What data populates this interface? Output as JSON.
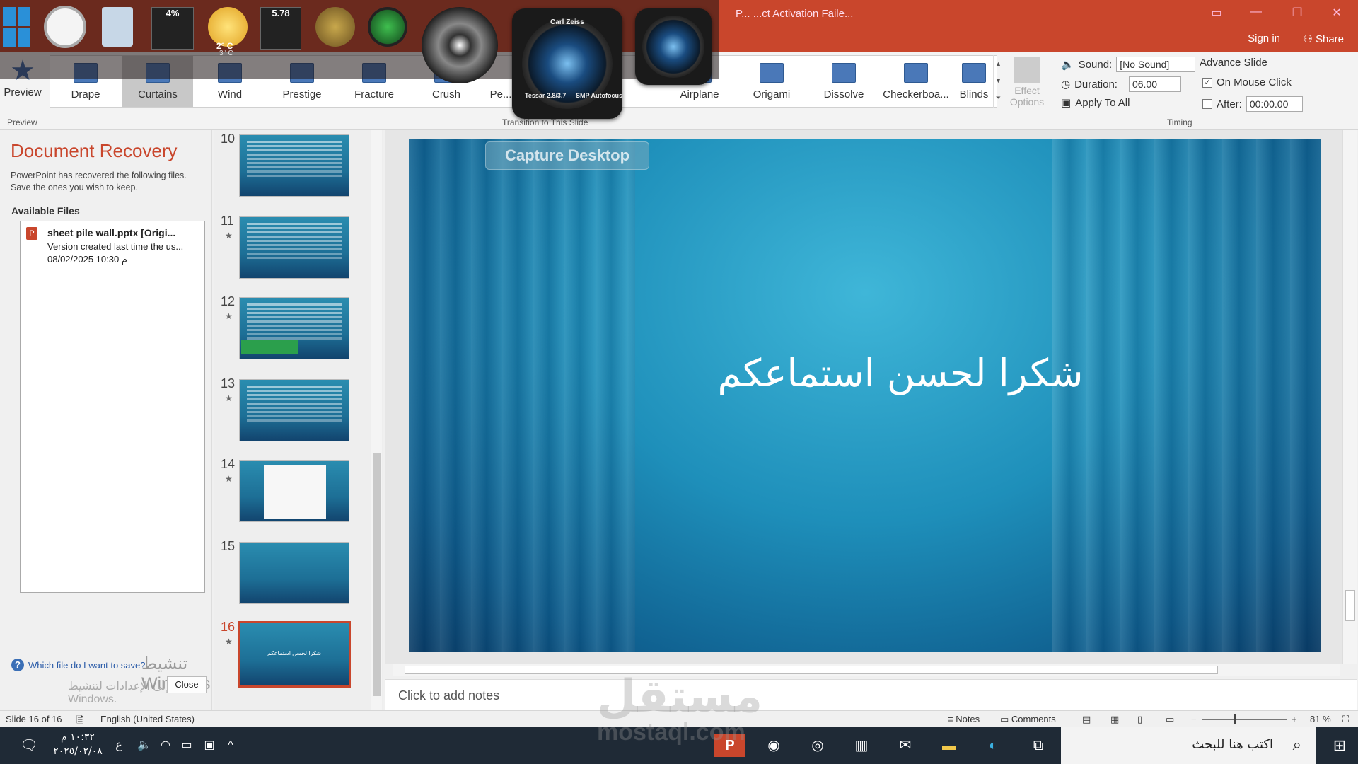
{
  "window": {
    "title": "P... ...ct Activation Faile...",
    "sign_in": "Sign in",
    "share": "Share"
  },
  "ribbon": {
    "preview_label": "Preview",
    "preview_group": "Preview",
    "transitions_group": "Transition to This Slide",
    "timing_group": "Timing",
    "transitions": [
      "Drape",
      "Curtains",
      "Wind",
      "Prestige",
      "Fracture",
      "Crush",
      "Pe...",
      "",
      "",
      "Airplane",
      "Origami",
      "Dissolve",
      "Checkerboa...",
      "Blinds"
    ],
    "selected_transition": "Curtains",
    "effect_options": "Effect Options",
    "sound_label": "Sound:",
    "sound_value": "[No Sound]",
    "duration_label": "Duration:",
    "duration_value": "06.00",
    "apply_all": "Apply To All",
    "advance_slide": "Advance Slide",
    "on_mouse_click": "On Mouse Click",
    "on_mouse_click_checked": true,
    "after_label": "After:",
    "after_value": "00:00.00",
    "after_checked": false
  },
  "recovery": {
    "title": "Document Recovery",
    "description": "PowerPoint has recovered the following files. Save the ones you wish to keep.",
    "available_files": "Available Files",
    "file_name": "sheet pile wall.pptx  [Origi...",
    "file_line1": "Version created last time the us...",
    "file_line2": "08/02/2025 10:30 م",
    "help_link": "Which file do I want to save?",
    "close": "Close",
    "watermark1": "تنشيط Windows",
    "watermark2": "انتقل إلى الإعدادات لتنشيط Windows."
  },
  "thumbnails": [
    {
      "num": "10",
      "star": false,
      "kind": "text"
    },
    {
      "num": "11",
      "star": true,
      "kind": "text"
    },
    {
      "num": "12",
      "star": true,
      "kind": "text"
    },
    {
      "num": "13",
      "star": true,
      "kind": "text"
    },
    {
      "num": "14",
      "star": true,
      "kind": "doc"
    },
    {
      "num": "15",
      "star": false,
      "kind": "blank"
    },
    {
      "num": "16",
      "star": true,
      "kind": "title",
      "selected": true
    }
  ],
  "slide": {
    "title": "شكرا لحسن استماعكم",
    "notes_placeholder": "Click to add notes"
  },
  "statusbar": {
    "slide_info": "Slide 16 of 16",
    "language": "English (United States)",
    "notes": "Notes",
    "comments": "Comments",
    "zoom": "81 %"
  },
  "taskbar": {
    "search_placeholder": "اكتب هنا للبحث",
    "time": "١٠:٣٢ م",
    "date": "٢٠٢٥/٠٢/٠٨",
    "lang": "ع"
  },
  "gadgets": {
    "cpu": "4%",
    "weather_temp": "2° C",
    "weather_low": "3° C",
    "meter": "5.78",
    "lens_brand": "Carl Zeiss",
    "lens_model": "SMP Autofocus",
    "lens_spec": "Tessar 2.8/3.7",
    "capture": "Capture Desktop"
  },
  "watermark_site": "mostaql.com",
  "watermark_site_ar": "مستقل",
  "colors": {
    "accent": "#c9462c",
    "slide_bg": "#1e8fba",
    "taskbar": "#1f2a36"
  }
}
